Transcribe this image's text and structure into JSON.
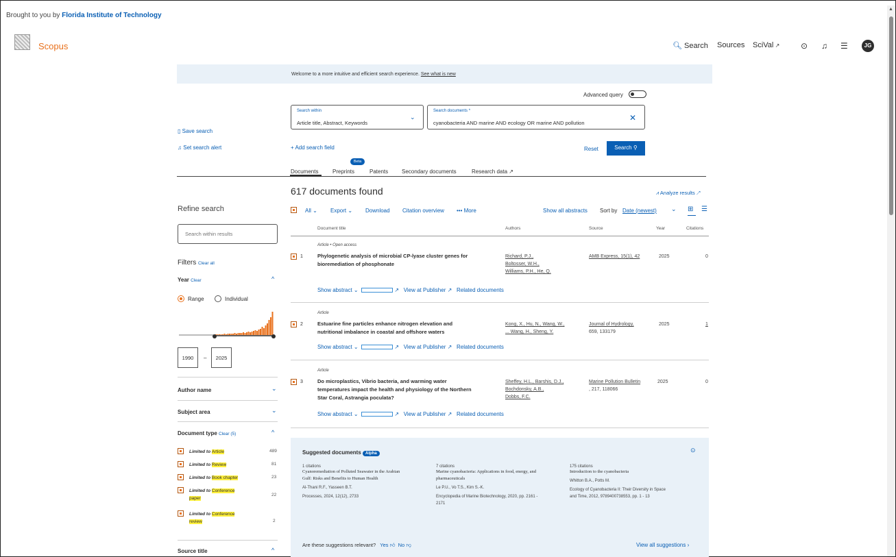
{
  "header": {
    "brought_prefix": "Brought to you by",
    "institution": "Florida Institute of Technology",
    "logo": "Scopus",
    "nav": {
      "search": "Search",
      "sources": "Sources",
      "scival": "SciVal",
      "avatar": "JG"
    }
  },
  "banner": {
    "text": "Welcome to a more intuitive and efficient search experience.",
    "link": "See what is new"
  },
  "search": {
    "advanced_query": "Advanced query",
    "within_label": "Search within",
    "within_value": "Article title, Abstract, Keywords",
    "documents_label": "Search documents *",
    "query": "cyanobacteria AND marine AND ecology OR marine AND pollution",
    "add_field": "Add search field",
    "reset": "Reset",
    "search_button": "Search"
  },
  "side_actions": {
    "save_search": "Save search",
    "set_alert": "Set search alert"
  },
  "tabs": [
    "Documents",
    "Preprints",
    "Patents",
    "Secondary documents",
    "Research data"
  ],
  "beta": "Beta",
  "results": {
    "found": "617 documents found",
    "analyze": "Analyze results",
    "toolbar": {
      "all": "All",
      "export": "Export",
      "download": "Download",
      "citation_overview": "Citation overview",
      "more": "More",
      "show_all_abstracts": "Show all abstracts",
      "sort_by": "Sort by",
      "sort_value": "Date (newest)"
    },
    "columns": {
      "title": "Document title",
      "authors": "Authors",
      "source": "Source",
      "year": "Year",
      "citations": "Citations"
    },
    "actions": {
      "show_abstract": "Show abstract",
      "view_publisher": "View at Publisher",
      "related": "Related documents"
    },
    "rows": [
      {
        "num": "1",
        "meta": "Article • Open access",
        "title1": "Phylogenetic analysis of microbial CP-lyase cluster genes for",
        "title2": "bioremediation of phosphonate",
        "title3": "",
        "auth1": "Richard, P.J.,",
        "auth2": "Boltosser, W.H.,",
        "auth3": "Williams, P.H., He, Q.",
        "src1": "AMB Express, 15(1), 42",
        "src2": "",
        "year": "2025",
        "cit": "0"
      },
      {
        "num": "2",
        "meta": "Article",
        "title1": "Estuarine fine particles enhance nitrogen elevation and",
        "title2": "nutritional imbalance in coastal and offshore waters",
        "title3": "",
        "auth1": "Kong, X., Hu, N., Wang, W.,",
        "auth2": "... Wang, H., Sheng, Y.",
        "auth3": "",
        "src1": "Journal of Hydrology,",
        "src2": "659, 133179",
        "year": "2025",
        "cit": "1"
      },
      {
        "num": "3",
        "meta": "Article",
        "title1": "Do microplastics, Vibrio bacteria, and warming water",
        "title2": "temperatures impact the health and physiology of the Northern",
        "title3": "Star Coral, Astrangia poculata?",
        "auth1": "Sheffey, H.L., Barshis, D.J.,",
        "auth2": "Bochdonsky, A.B.,",
        "auth3": "Dobbs, F.C.",
        "src1": "Marine Pollution Bulletin",
        "src2": ", 217, 118066",
        "year": "2025",
        "cit": "0"
      }
    ]
  },
  "sidebar": {
    "refine": "Refine search",
    "search_within_placeholder": "Search within results",
    "filters": "Filters",
    "clear_all": "Clear all",
    "year": "Year",
    "clear": "Clear",
    "range": "Range",
    "individual": "Individual",
    "year_from": "1990",
    "year_to": "2025",
    "author_name": "Author name",
    "subject_area": "Subject area",
    "document_type": "Document type",
    "clear_5": "Clear (5)",
    "limited_to": "Limited to",
    "doc_types": [
      {
        "label": "Article",
        "count": "489"
      },
      {
        "label": "Review",
        "count": "81"
      },
      {
        "label": "Book chapter",
        "count": "23"
      },
      {
        "label": "Conference paper",
        "count": "22"
      },
      {
        "label": "Conference review",
        "count": "2"
      }
    ],
    "source_title": "Source title"
  },
  "suggested": {
    "heading": "Suggested documents",
    "alpha": "Alpha",
    "items": [
      {
        "cites": "1 citations",
        "t1": "Cyanoremediation of Polluted Seawater in the Arabian",
        "t2": "Gulf: Risks and Benefits to Human Health",
        "authors": "Al-Thani R.F., Yasseen B.T.",
        "src1": "Processes, 2024, 12(12), 2733",
        "src2": ""
      },
      {
        "cites": "7 citations",
        "t1": "Marine cyanobacteria: Applications in food, energy, and",
        "t2": "pharmaceuticals",
        "authors": "Le P.U., Vo T.S., Kim S.-K.",
        "src1": "Encyclopedia of Marine Biotechnology, 2020, pp. 2161 -",
        "src2": "2171"
      },
      {
        "cites": "175 citations",
        "t1": "Introduction to the cyanobacteria",
        "t2": "",
        "authors": "Whitton B.A., Potts M.",
        "src1": "Ecology of Cyanobacteria II: Their Diversity in Space",
        "src2": "and Time, 2012, 9789400738553, pp. 1 - 13"
      }
    ],
    "relevant": "Are these suggestions relevant?",
    "yes": "Yes",
    "no": "No",
    "view_all": "View all suggestions"
  },
  "colors": {
    "accent": "#e9711c",
    "link": "#0a5fb4",
    "banner": "#e9f1f8"
  }
}
